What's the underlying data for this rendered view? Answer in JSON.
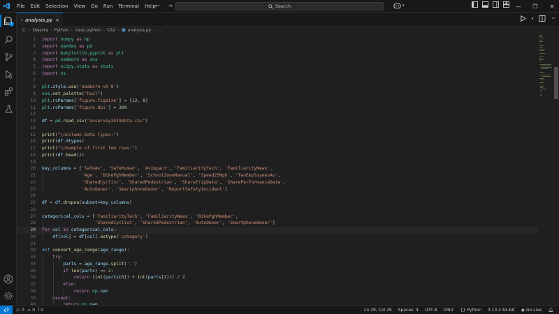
{
  "titlebar": {
    "menu": [
      "File",
      "Edit",
      "Selection",
      "View",
      "Go",
      "Run",
      "Terminal",
      "Help"
    ],
    "search_label": "Search"
  },
  "tab": {
    "name": "analysis.py",
    "close": "×"
  },
  "breadcrumb": [
    "C:",
    "Dwarka",
    "Python",
    "class python",
    "CA2",
    "analysis.py",
    "..."
  ],
  "editor": {
    "current_line": 29,
    "lines": [
      {
        "n": "1",
        "code": "import numpy as np"
      },
      {
        "n": "2",
        "code": "import pandas as pd"
      },
      {
        "n": "3",
        "code": "import matplotlib.pyplot as plt"
      },
      {
        "n": "4",
        "code": "import seaborn as sns"
      },
      {
        "n": "5",
        "code": "import scipy.stats as stats"
      },
      {
        "n": "6",
        "code": "import os"
      },
      {
        "n": "7",
        "code": ""
      },
      {
        "n": "8",
        "code": "plt.style.use('seaborn-v0_8')"
      },
      {
        "n": "9",
        "code": "sns.set_palette(\"husl\")"
      },
      {
        "n": "10",
        "code": "plt.rcParams['figure.figsize'] = [12, 8]"
      },
      {
        "n": "11",
        "code": "plt.rcParams['figure.dpi'] = 300"
      },
      {
        "n": "12",
        "code": ""
      },
      {
        "n": "13",
        "code": "df = pd.read_csv(\"avsurvey2019data.csv\")"
      },
      {
        "n": "14",
        "code": ""
      },
      {
        "n": "15",
        "code": "print(\"\\nColumn Data Types:\")"
      },
      {
        "n": "16",
        "code": "print(df.dtypes)"
      },
      {
        "n": "17",
        "code": "print(\"\\nSample of first few rows:\")"
      },
      {
        "n": "18",
        "code": "print(df.head())"
      },
      {
        "n": "19",
        "code": ""
      },
      {
        "n": "20",
        "code": "key_columns = ['SafeAv', 'SafeHuman', 'AvImpact', 'FamiliarityTech', 'FamiliarityNews',"
      },
      {
        "n": "21",
        "code": "               'Age', 'BikePghMember', 'SchoolZoneManual', 'Speed25Mph', 'TwoEmployeesAv',"
      },
      {
        "n": "22",
        "code": "               'SharedCyclist', 'SharedPedestrian', 'ShareTripData', 'SharePerformanceData',"
      },
      {
        "n": "23",
        "code": "               'AutoOwner', 'SmartphoneOwner', 'ReportSafetyIncident']"
      },
      {
        "n": "24",
        "code": ""
      },
      {
        "n": "25",
        "code": "df = df.dropna(subset=key_columns)"
      },
      {
        "n": "26",
        "code": ""
      },
      {
        "n": "27",
        "code": "categorical_cols = ['FamiliarityTech', 'FamiliarityNews', 'BikePghMember',"
      },
      {
        "n": "28",
        "code": "                    'SharedCyclist', 'SharedPedestrian', 'AutoOwner', 'SmartphoneOwner']"
      },
      {
        "n": "29",
        "code": "for col in categorical_cols:"
      },
      {
        "n": "30",
        "code": "    df[col] = df[col].astype('category')"
      },
      {
        "n": "31",
        "code": ""
      },
      {
        "n": "32",
        "code": "def convert_age_range(age_range):"
      },
      {
        "n": "33",
        "code": "    try:"
      },
      {
        "n": "34",
        "code": "        parts = age_range.split('-')"
      },
      {
        "n": "35",
        "code": "        if len(parts) == 2:"
      },
      {
        "n": "36",
        "code": "            return (int(parts[0]) + int(parts[1])) / 2"
      },
      {
        "n": "37",
        "code": "        else:"
      },
      {
        "n": "38",
        "code": "            return np.nan"
      },
      {
        "n": "39",
        "code": "    except:"
      },
      {
        "n": "40",
        "code": "        return np.nan"
      }
    ]
  },
  "statusbar": {
    "errors": "0",
    "warnings": "0",
    "ports": "0",
    "position": "Ln 29, Col 29",
    "spaces": "Spaces: 4",
    "encoding": "UTF-8",
    "eol": "CRLF",
    "language": "Python",
    "interpreter": "3.13.2 64-bit",
    "golive": "Go Live"
  },
  "colors": {
    "keyword": "#c586c0",
    "string": "#ce9178",
    "number": "#b5cea8",
    "function": "#dcdcaa",
    "variable": "#9cdcfe",
    "class": "#4ec9b0",
    "define": "#569cd6",
    "accent": "#0078d4"
  }
}
